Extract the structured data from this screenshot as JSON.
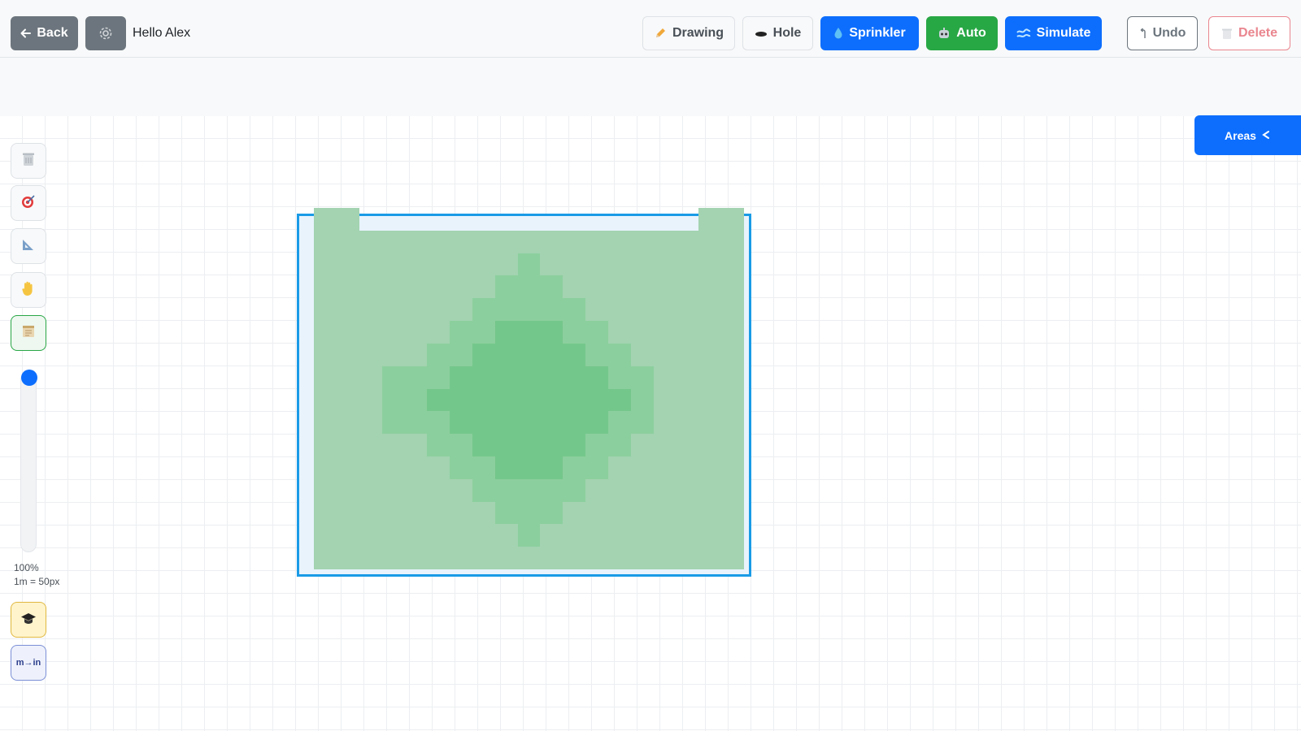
{
  "header": {
    "back_label": "Back",
    "back_icon": "arrow-left-icon",
    "settings_icon": "gear-icon",
    "greeting": "Hello Alex",
    "tools": [
      {
        "id": "drawing",
        "label": "Drawing",
        "icon": "pencil-icon"
      },
      {
        "id": "hole",
        "label": "Hole",
        "icon": "hole-icon"
      },
      {
        "id": "sprinkler",
        "label": "Sprinkler",
        "icon": "water-drop-icon"
      },
      {
        "id": "auto",
        "label": "Auto",
        "icon": "robot-icon"
      },
      {
        "id": "simulate",
        "label": "Simulate",
        "icon": "wave-icon"
      }
    ],
    "undo_label": "Undo",
    "delete_label": "Delete"
  },
  "sidebar": {
    "tools": [
      "trash-icon",
      "target-icon",
      "ruler-icon",
      "hand-icon",
      "notepad-icon"
    ],
    "zoom_percent": "100%",
    "scale": "1m = 50px",
    "zoom_level": 1.0,
    "learn_icon": "graduation-cap-icon",
    "unit_toggle": "m→in"
  },
  "panel": {
    "areas_label": "Areas",
    "areas_icon": "chevron-left-icon"
  },
  "colors": {
    "primary": "#0d6efd",
    "success": "#28a745",
    "area_border": "#1a9be6",
    "coverage_low": "#a3d3b1",
    "coverage_mid": "#8ccf9e",
    "coverage_high": "#74c78b"
  }
}
